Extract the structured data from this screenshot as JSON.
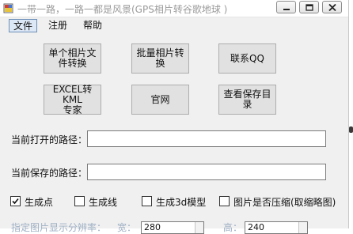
{
  "window": {
    "title": "一带一路，一路一都是风景(GPS相片转谷歌地球 )"
  },
  "menu": {
    "items": [
      "文件",
      "注册",
      "帮助"
    ]
  },
  "buttons": {
    "single_convert": [
      "单个相片文",
      "件转换"
    ],
    "batch_convert": [
      "批量相片转",
      "换"
    ],
    "contact_qq": "联系QQ",
    "excel_to_kml": [
      "EXCEL转KML",
      "专家"
    ],
    "website": "官网",
    "view_save_dir": [
      "查看保存目",
      "录"
    ]
  },
  "paths": {
    "open_label": "当前打开的路径：",
    "open_value": "",
    "save_label": "当前保存的路径：",
    "save_value": ""
  },
  "options": {
    "gen_points": {
      "label": "生成点",
      "checked": true
    },
    "gen_lines": {
      "label": "生成线",
      "checked": false
    },
    "gen_3d": {
      "label": "生成3d模型",
      "checked": false
    },
    "compress": {
      "label": "图片是否压缩(取缩略图)",
      "checked": false
    }
  },
  "resolution": {
    "label": "指定图片显示分辨率：",
    "width_label": "宽：",
    "width_value": "280",
    "height_label": "高：",
    "height_value": "240"
  },
  "colors": {
    "window_bg": "#f0f0f0",
    "button_bg": "#e1e1e1",
    "button_border": "#adadad",
    "menu_active_bg": "#dde8f6",
    "title_text": "#9a9a9a"
  }
}
